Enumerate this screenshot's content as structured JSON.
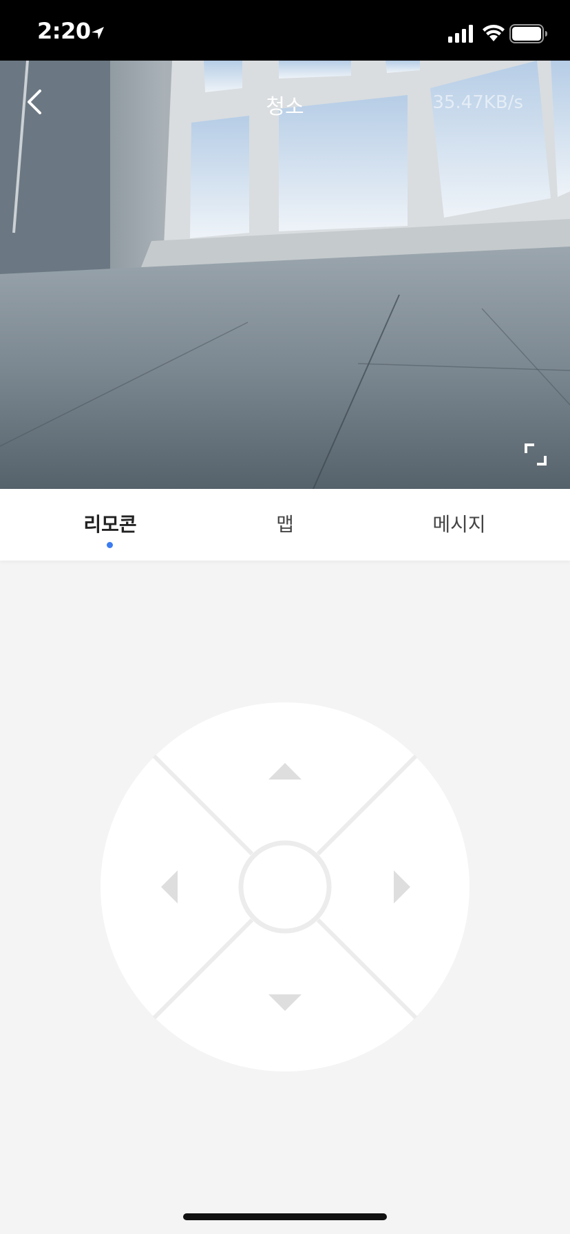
{
  "status_bar": {
    "time": "2:20"
  },
  "video": {
    "title": "청소",
    "speed": "35.47KB/s",
    "back_icon": "chevron-left-icon",
    "fullscreen_icon": "fullscreen-icon"
  },
  "tabs": [
    {
      "label": "리모콘",
      "active": true
    },
    {
      "label": "맵",
      "active": false
    },
    {
      "label": "메시지",
      "active": false
    }
  ],
  "colors": {
    "accent": "#3c7cf0",
    "background": "#f4f4f4",
    "joystick": "#ffffff",
    "joystick_lines": "#ececec",
    "arrows": "#dedede"
  },
  "icons": {
    "up": "arrow-up-icon",
    "down": "arrow-down-icon",
    "left": "arrow-left-icon",
    "right": "arrow-right-icon"
  }
}
